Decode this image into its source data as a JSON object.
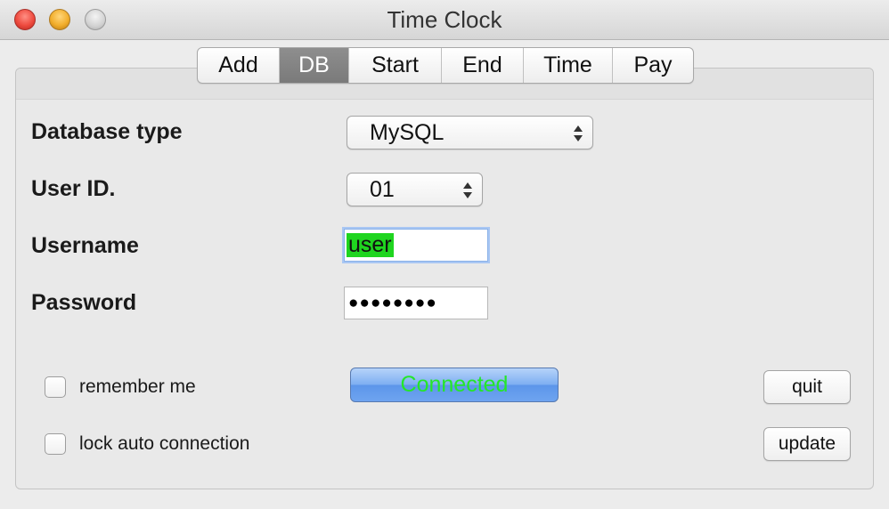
{
  "window": {
    "title": "Time Clock"
  },
  "tabs": [
    {
      "label": "Add",
      "active": false
    },
    {
      "label": "DB",
      "active": true
    },
    {
      "label": "Start",
      "active": false
    },
    {
      "label": "End",
      "active": false
    },
    {
      "label": "Time",
      "active": false
    },
    {
      "label": "Pay",
      "active": false
    }
  ],
  "form": {
    "database_type": {
      "label": "Database type",
      "value": "MySQL"
    },
    "user_id": {
      "label": "User ID.",
      "value": "01"
    },
    "username": {
      "label": "Username",
      "value": "user"
    },
    "password": {
      "label": "Password",
      "value": "●●●●●●●●"
    }
  },
  "options": {
    "remember_me": {
      "label": "remember me",
      "checked": false
    },
    "lock_auto_connection": {
      "label": "lock auto connection",
      "checked": false
    }
  },
  "status": {
    "connection_label": "Connected",
    "connection_color": "#24e62a"
  },
  "buttons": {
    "quit": "quit",
    "update": "update"
  },
  "colors": {
    "selection_highlight": "#1fd51f",
    "active_tab": "#8e8e8e",
    "status_button": "#6ea4f0"
  }
}
